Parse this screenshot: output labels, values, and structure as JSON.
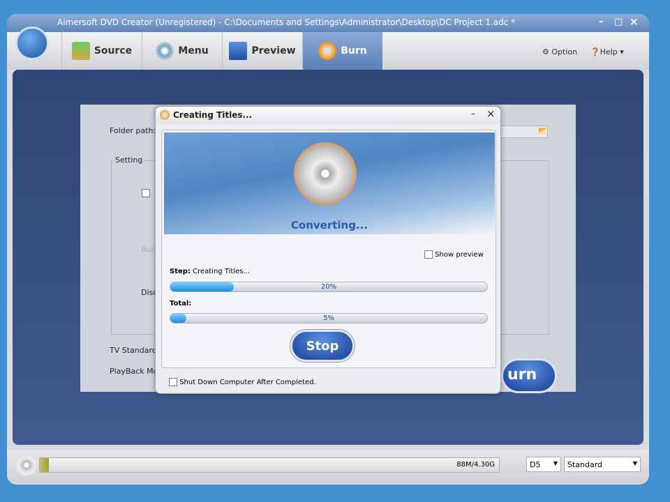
{
  "window": {
    "title": "Aimersoft DVD Creator (Unregistered) - C:\\Documents and Settings\\Administrator\\Desktop\\DC Project 1.adc *",
    "min": "–",
    "max": "□",
    "close": "×"
  },
  "toolbar": {
    "tabs": [
      {
        "label": "Source",
        "icon": "download-icon"
      },
      {
        "label": "Menu",
        "icon": "disc-icon"
      },
      {
        "label": "Preview",
        "icon": "monitor-play-icon"
      },
      {
        "label": "Burn",
        "icon": "burn-disc-icon",
        "active": true
      }
    ],
    "option": "Option",
    "help": "Help ▾"
  },
  "panel": {
    "folder_path": "Folder path:",
    "setting": "Setting",
    "burn": "Burn",
    "disc": "Disc",
    "tv_standard": "TV Standard:",
    "playback_mode": "PlayBack Mode",
    "burn_button": "urn"
  },
  "dialog": {
    "title": "Creating Titles...",
    "status": "Converting...",
    "show_preview": "Show preview",
    "step_label": "Step:",
    "step_value": "Creating Titles...",
    "step_progress": 20,
    "step_pct": "20%",
    "total_label": "Total:",
    "total_progress": 5,
    "total_pct": "5%",
    "stop": "Stop",
    "shutdown": "Shut Down Computer After Completed.",
    "min": "–",
    "close": "×"
  },
  "bottom": {
    "capacity": "88M/4.30G",
    "capacity_fill_percent": 2,
    "disc_type": "D5",
    "quality": "Standard"
  },
  "colors": {
    "accent": "#4190cf",
    "progress": "#1a8de0"
  }
}
